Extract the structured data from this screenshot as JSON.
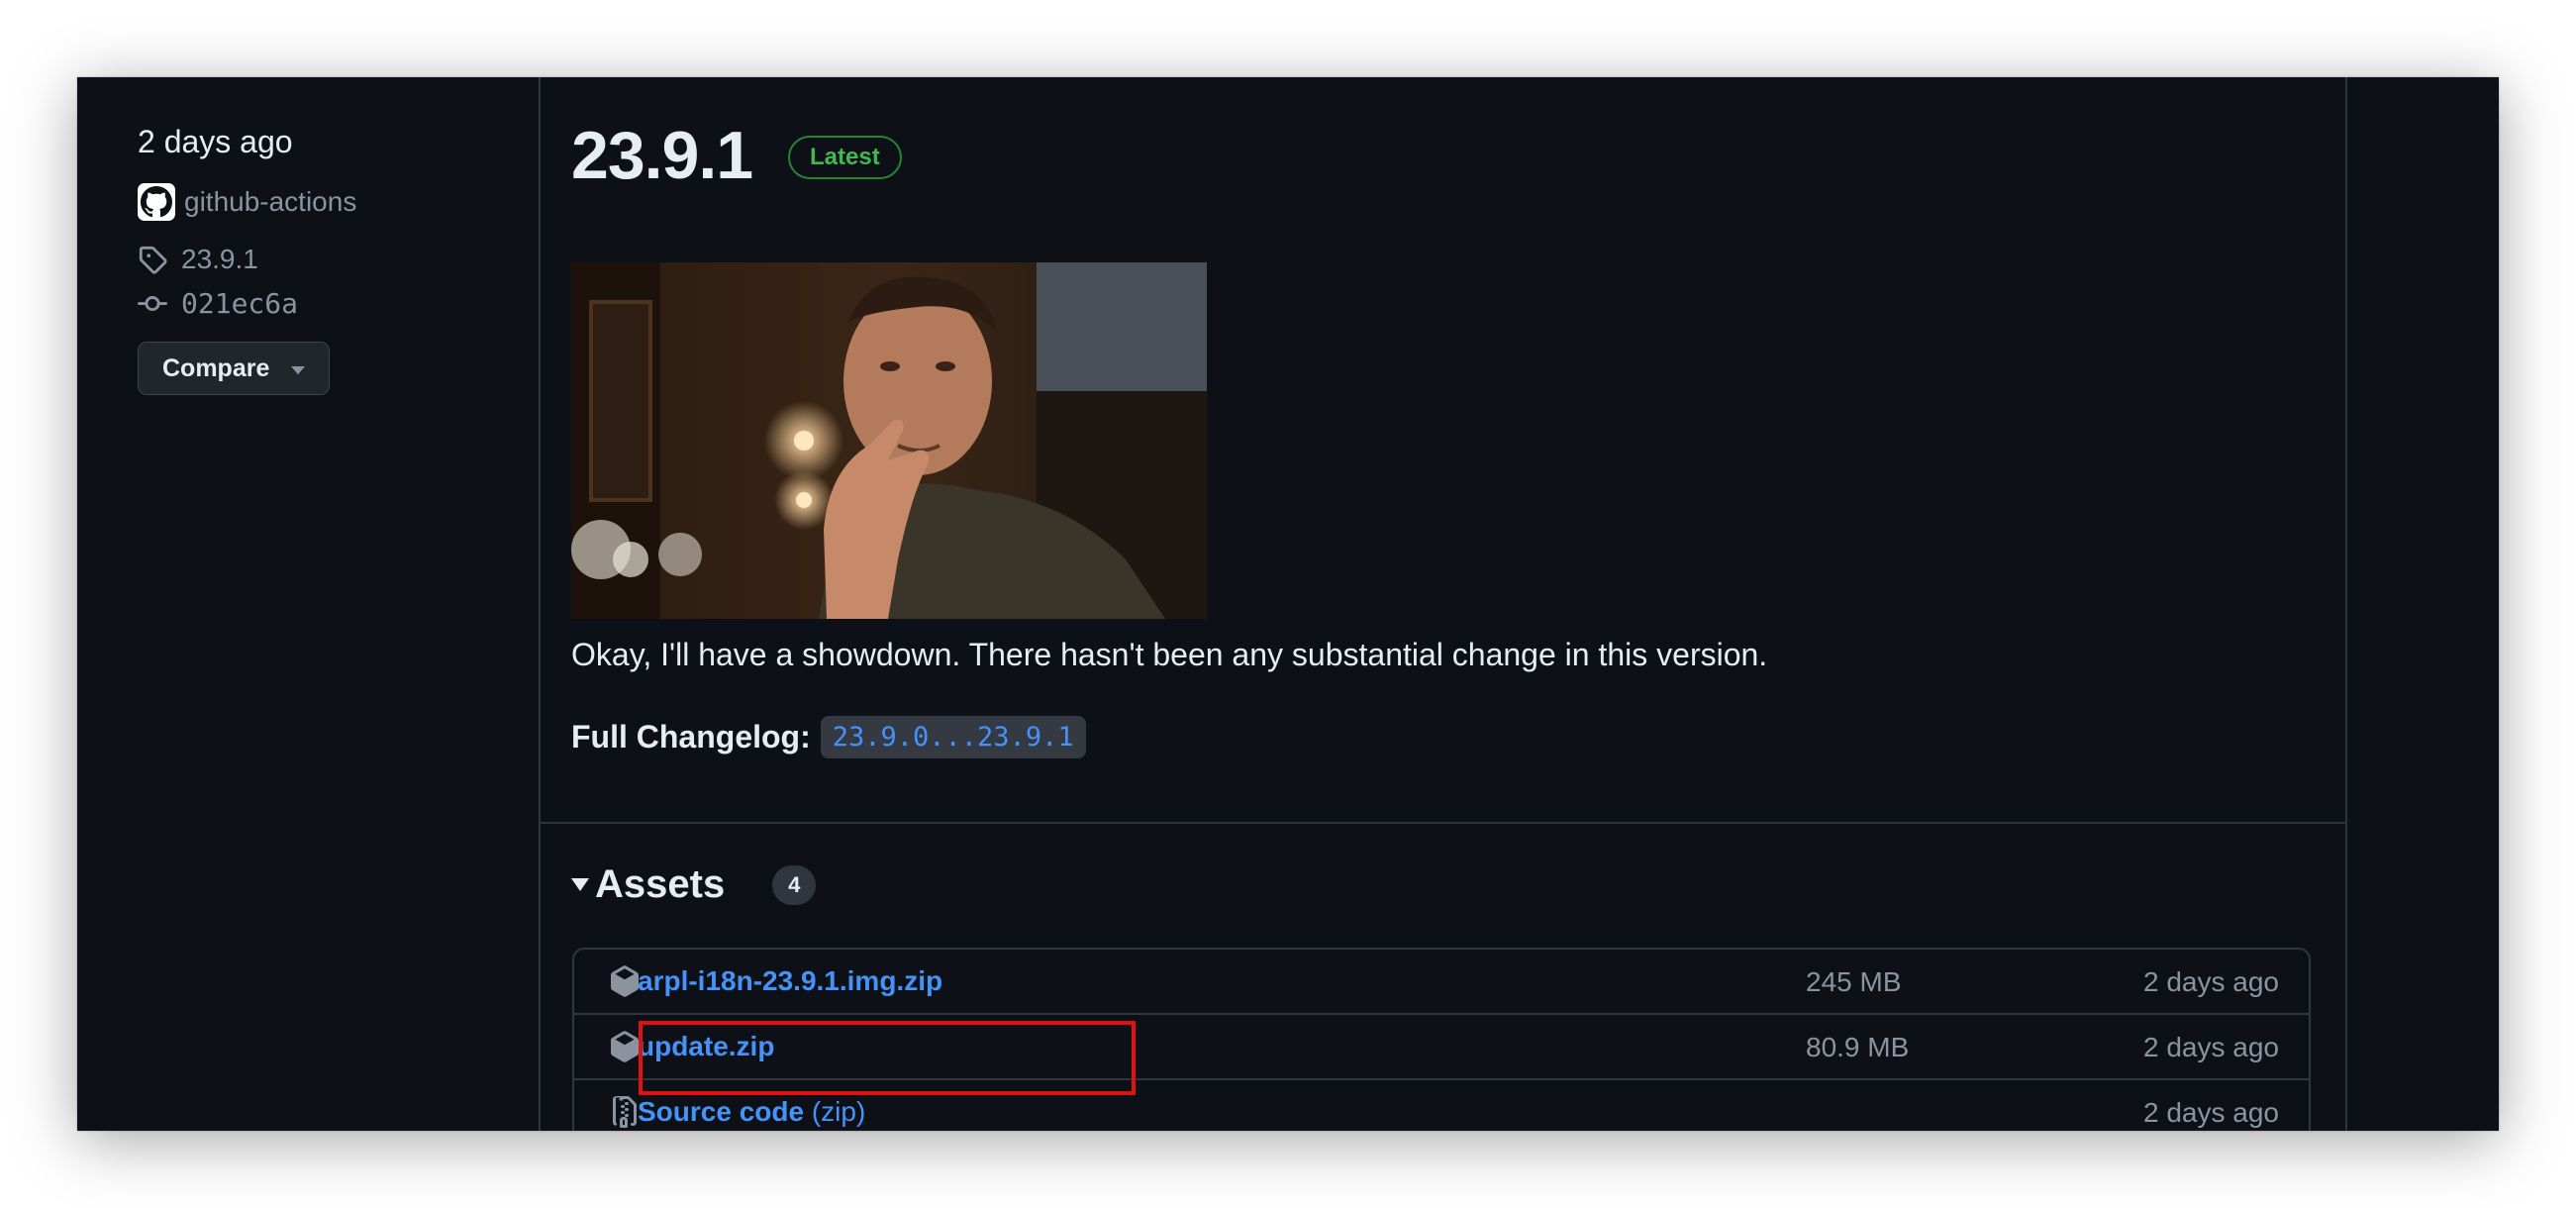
{
  "release_meta": {
    "date": "2 days ago",
    "author": "github-actions",
    "tag": "23.9.1",
    "commit": "021ec6a",
    "compare_label": "Compare"
  },
  "release": {
    "title": "23.9.1",
    "badge": "Latest",
    "description": "Okay, I'll have a showdown. There hasn't been any substantial change in this version.",
    "changelog_label": "Full Changelog:",
    "changelog_link": "23.9.0...23.9.1"
  },
  "assets": {
    "title": "Assets",
    "count": "4",
    "items": [
      {
        "name": "arpl-i18n-23.9.1.img.zip",
        "suffix": "",
        "size": "245 MB",
        "date": "2 days ago",
        "icon": "package-icon"
      },
      {
        "name": "update.zip",
        "suffix": "",
        "size": "80.9 MB",
        "date": "2 days ago",
        "icon": "package-icon"
      },
      {
        "name": "Source code",
        "suffix": "(zip)",
        "size": "",
        "date": "2 days ago",
        "icon": "file-zip-icon"
      }
    ]
  },
  "colors": {
    "background": "#0d1117",
    "text": "#e6edf3",
    "muted": "#8b949e",
    "link": "#4493f8",
    "latest_green": "#3fb950",
    "highlight_red": "#e0110f"
  }
}
